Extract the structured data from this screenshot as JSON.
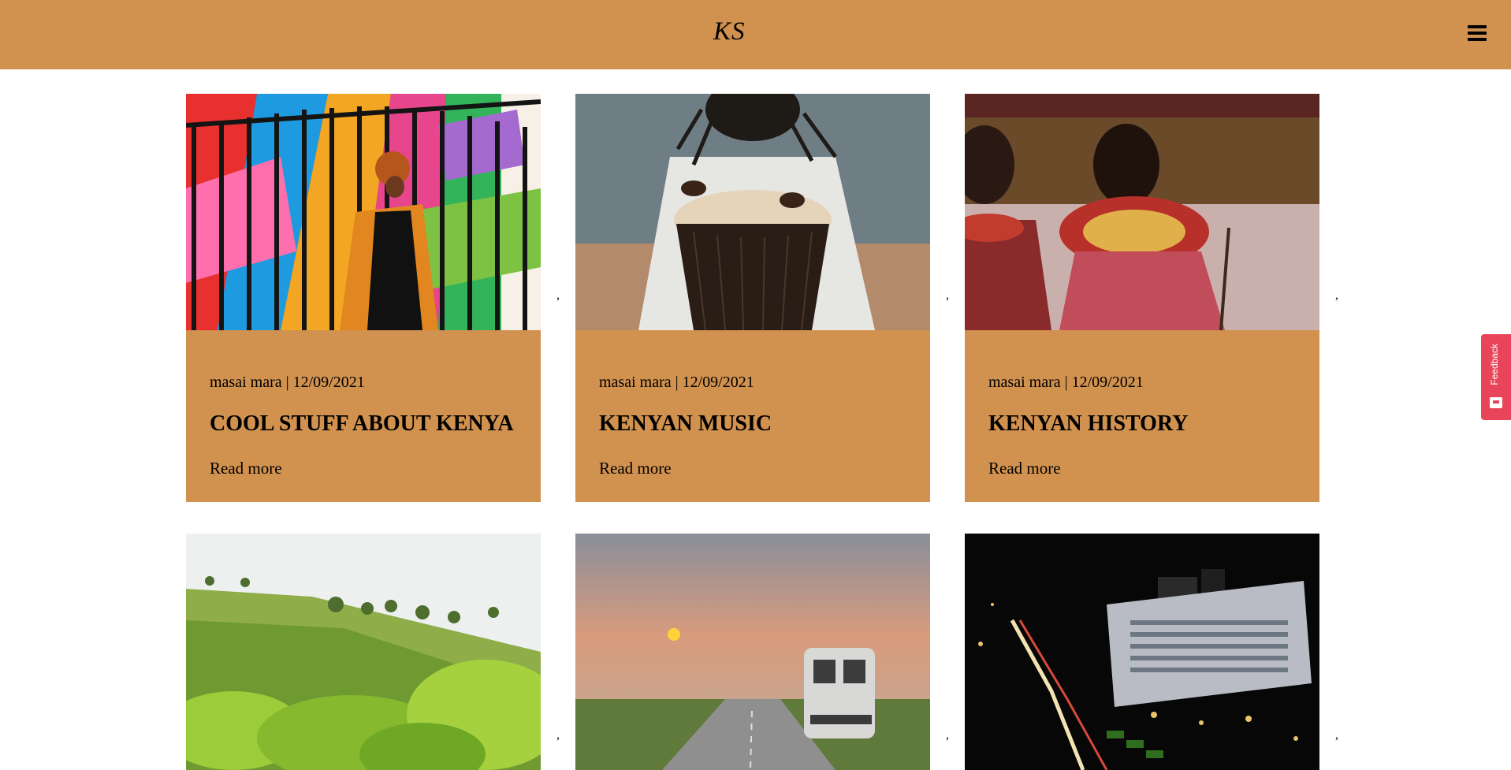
{
  "header": {
    "logo": "KS",
    "menu_icon": "hamburger-menu-icon",
    "background_color": "#d1914f"
  },
  "cards": [
    {
      "meta": "masai mara | 12/09/2021",
      "title": "COOL STUFF ABOUT KENYA",
      "read_more": "Read more",
      "image": "woman-colorful-fence-photo"
    },
    {
      "meta": "masai mara | 12/09/2021",
      "title": "KENYAN MUSIC",
      "read_more": "Read more",
      "image": "drummer-photo"
    },
    {
      "meta": "masai mara | 12/09/2021",
      "title": "KENYAN HISTORY",
      "read_more": "Read more",
      "image": "maasai-women-photo"
    },
    {
      "image": "tea-plantation-photo"
    },
    {
      "image": "sunset-road-van-photo"
    },
    {
      "image": "nairobi-night-city-photo"
    }
  ],
  "separator": ",",
  "feedback": {
    "label": "Feedback",
    "icon": "feedback-icon",
    "color": "#e8455a"
  }
}
